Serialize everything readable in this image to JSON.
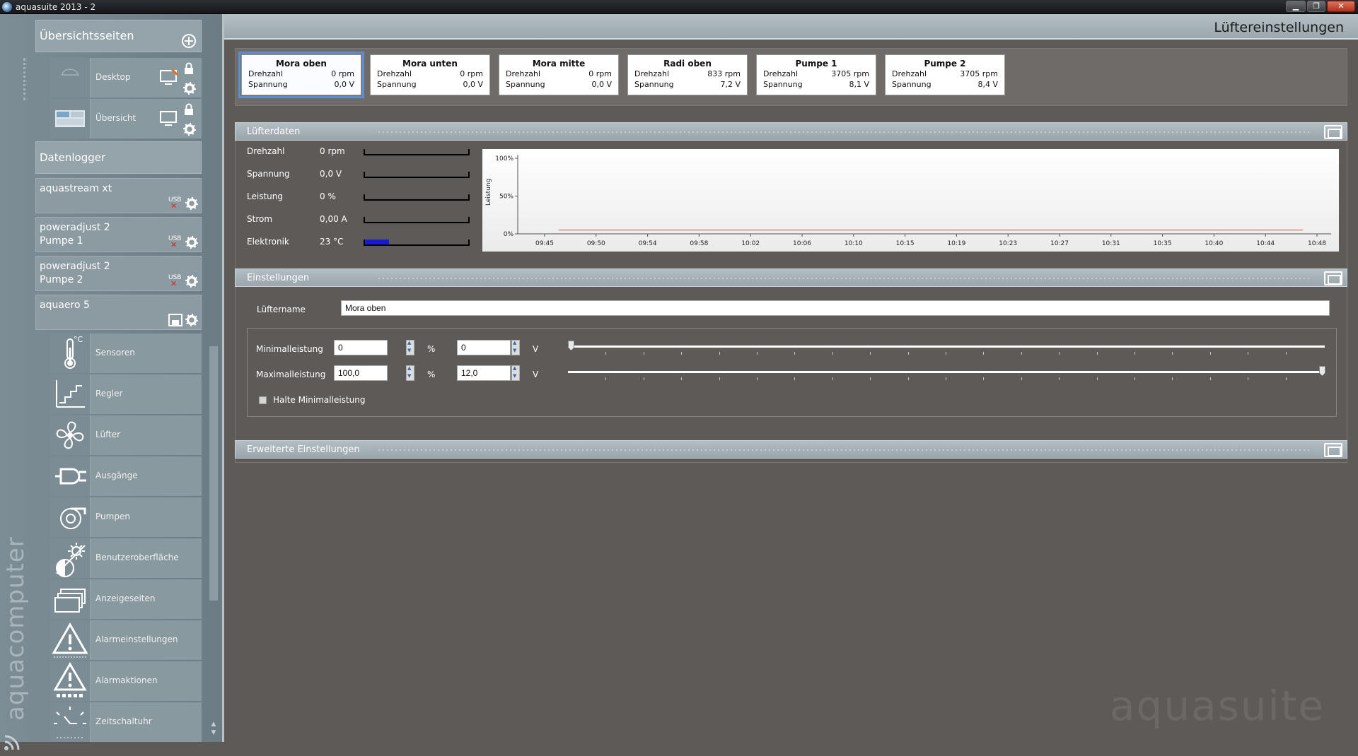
{
  "window": {
    "title": "aquasuite 2013 - 2",
    "minimize": "▁",
    "maximize": "❐",
    "close": "✕"
  },
  "sidebar": {
    "overview_header": "Übersichtsseiten",
    "overview_items": [
      {
        "label": "Desktop"
      },
      {
        "label": "Übersicht"
      }
    ],
    "datalogger": "Datenlogger",
    "devices": [
      {
        "label": "aquastream xt",
        "usb": "USB"
      },
      {
        "label": "poweradjust 2",
        "label2": "Pumpe 1",
        "usb": "USB"
      },
      {
        "label": "poweradjust 2",
        "label2": "Pumpe 2",
        "usb": "USB"
      },
      {
        "label": "aquaero 5"
      }
    ],
    "aquaero_items": [
      {
        "label": "Sensoren",
        "icon": "thermometer-icon",
        "unit": "°C"
      },
      {
        "label": "Regler",
        "icon": "controller-icon"
      },
      {
        "label": "Lüfter",
        "icon": "fan-icon"
      },
      {
        "label": "Ausgänge",
        "icon": "plug-icon"
      },
      {
        "label": "Pumpen",
        "icon": "pump-icon"
      },
      {
        "label": "Benutzeroberfläche",
        "icon": "brightness-icon"
      },
      {
        "label": "Anzeigeseiten",
        "icon": "pages-icon"
      },
      {
        "label": "Alarmeinstellungen",
        "icon": "alarm-icon"
      },
      {
        "label": "Alarmaktionen",
        "icon": "alarm-actions-icon"
      },
      {
        "label": "Zeitschaltuhr",
        "icon": "timer-icon"
      }
    ],
    "brand": "aquacomputer"
  },
  "page": {
    "title": "Lüftereinstellungen",
    "watermark": "aquasuite"
  },
  "fans": [
    {
      "name": "Mora oben",
      "rpm_label": "Drehzahl",
      "rpm": "0 rpm",
      "v_label": "Spannung",
      "v": "0,0 V",
      "selected": true
    },
    {
      "name": "Mora unten",
      "rpm_label": "Drehzahl",
      "rpm": "0 rpm",
      "v_label": "Spannung",
      "v": "0,0 V"
    },
    {
      "name": "Mora mitte",
      "rpm_label": "Drehzahl",
      "rpm": "0 rpm",
      "v_label": "Spannung",
      "v": "0,0 V"
    },
    {
      "name": "Radi oben",
      "rpm_label": "Drehzahl",
      "rpm": "833 rpm",
      "v_label": "Spannung",
      "v": "7,2 V"
    },
    {
      "name": "Pumpe 1",
      "rpm_label": "Drehzahl",
      "rpm": "3705 rpm",
      "v_label": "Spannung",
      "v": "8,1 V"
    },
    {
      "name": "Pumpe 2",
      "rpm_label": "Drehzahl",
      "rpm": "3705 rpm",
      "v_label": "Spannung",
      "v": "8,4 V"
    }
  ],
  "luefterdaten": {
    "title": "Lüfterdaten",
    "stats": [
      {
        "label": "Drehzahl",
        "value": "0 rpm",
        "fill": 0
      },
      {
        "label": "Spannung",
        "value": "0,0 V",
        "fill": 0
      },
      {
        "label": "Leistung",
        "value": "0 %",
        "fill": 0
      },
      {
        "label": "Strom",
        "value": "0,00 A",
        "fill": 0
      },
      {
        "label": "Elektronik",
        "value": "23 °C",
        "fill": 0.23,
        "fill_color": "#1919d8"
      }
    ]
  },
  "chart_data": {
    "type": "line",
    "ylabel": "Leistung",
    "yticks": [
      "0%",
      "50%",
      "100%"
    ],
    "ylim": [
      0,
      100
    ],
    "x": [
      "09:45",
      "09:50",
      "09:54",
      "09:58",
      "10:02",
      "10:06",
      "10:10",
      "10:15",
      "10:19",
      "10:23",
      "10:27",
      "10:31",
      "10:35",
      "10:40",
      "10:44",
      "10:48"
    ],
    "series": [
      {
        "values": [
          5,
          5,
          5,
          5,
          5,
          5,
          5,
          5,
          5,
          5,
          5,
          5,
          5,
          5,
          5,
          5
        ],
        "color": "#c0504d"
      }
    ],
    "grid": false
  },
  "einstellungen": {
    "title": "Einstellungen",
    "name_label": "Lüftername",
    "name_value": "Mora oben",
    "min_label": "Minimalleistung",
    "min_percent": "0",
    "min_volt": "0",
    "max_label": "Maximalleistung",
    "max_percent": "100,0",
    "max_volt": "12,0",
    "percent_unit": "%",
    "volt_unit": "V",
    "min_slider_level": 0,
    "max_slider_level": 1,
    "hold_label": "Halte Minimalleistung",
    "hold_checked": false
  },
  "erweitert": {
    "title": "Erweiterte Einstellungen"
  }
}
